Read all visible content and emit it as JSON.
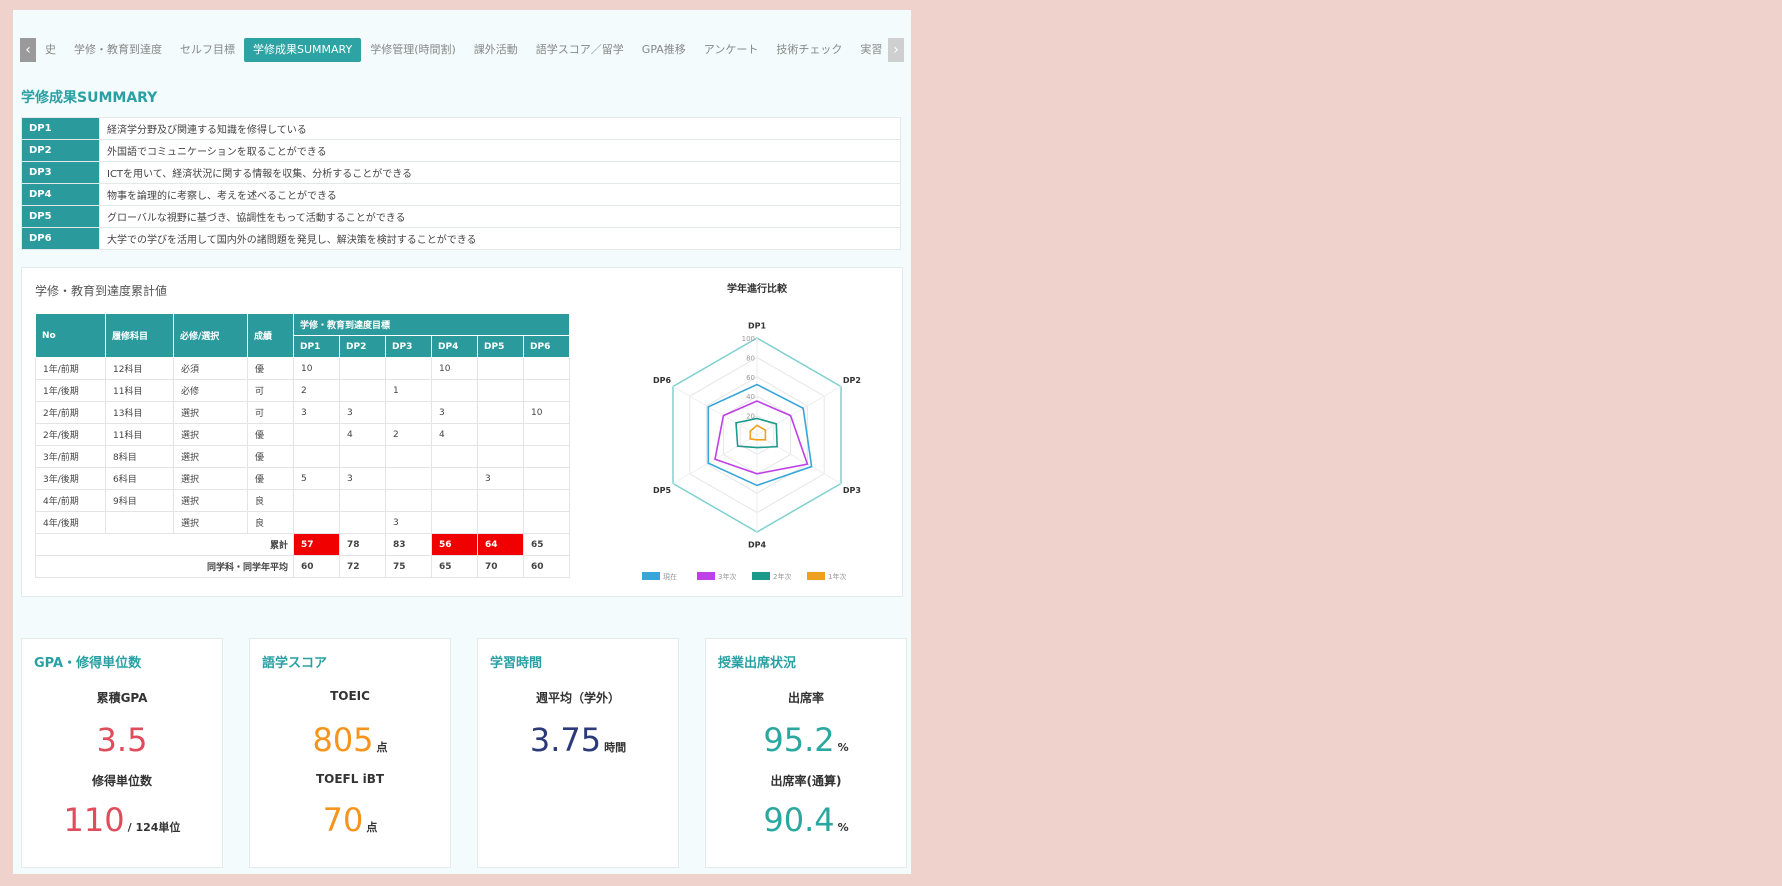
{
  "tabs": {
    "items": [
      "史",
      "学修・教育到達度",
      "セルフ目標",
      "学修成果SUMMARY",
      "学修管理(時間割)",
      "課外活動",
      "語学スコア／留学",
      "GPA推移",
      "アンケート",
      "技術チェック",
      "実習"
    ],
    "active_index": 3
  },
  "summary": {
    "title": "学修成果SUMMARY",
    "dp_list": [
      {
        "code": "DP1",
        "text": "経済学分野及び関連する知識を修得している"
      },
      {
        "code": "DP2",
        "text": "外国語でコミュニケーションを取ることができる"
      },
      {
        "code": "DP3",
        "text": "ICTを用いて、経済状況に関する情報を収集、分析することができる"
      },
      {
        "code": "DP4",
        "text": "物事を論理的に考察し、考えを述べることができる"
      },
      {
        "code": "DP5",
        "text": "グローバルな視野に基づき、協調性をもって活動することができる"
      },
      {
        "code": "DP6",
        "text": "大学での学びを活用して国内外の諸問題を発見し、解決策を検討することができる"
      }
    ]
  },
  "cumulative": {
    "title": "学修・教育到達度累計値",
    "headers": {
      "no": "No",
      "course": "履修科目",
      "req": "必修/選択",
      "grade": "成績",
      "target": "学修・教育到達度目標",
      "dps": [
        "DP1",
        "DP2",
        "DP3",
        "DP4",
        "DP5",
        "DP6"
      ]
    },
    "rows": [
      {
        "no": "1年/前期",
        "course": "12科目",
        "req": "必須",
        "grade": "優",
        "dp": [
          "10",
          "",
          "",
          "10",
          "",
          ""
        ]
      },
      {
        "no": "1年/後期",
        "course": "11科目",
        "req": "必修",
        "grade": "可",
        "dp": [
          "2",
          "",
          "1",
          "",
          "",
          ""
        ]
      },
      {
        "no": "2年/前期",
        "course": "13科目",
        "req": "選択",
        "grade": "可",
        "dp": [
          "3",
          "3",
          "",
          "3",
          "",
          "10"
        ]
      },
      {
        "no": "2年/後期",
        "course": "11科目",
        "req": "選択",
        "grade": "優",
        "dp": [
          "",
          "4",
          "2",
          "4",
          "",
          ""
        ]
      },
      {
        "no": "3年/前期",
        "course": "8科目",
        "req": "選択",
        "grade": "優",
        "dp": [
          "",
          "",
          "",
          "",
          "",
          ""
        ]
      },
      {
        "no": "3年/後期",
        "course": "6科目",
        "req": "選択",
        "grade": "優",
        "dp": [
          "5",
          "3",
          "",
          "",
          "3",
          ""
        ]
      },
      {
        "no": "4年/前期",
        "course": "9科目",
        "req": "選択",
        "grade": "良",
        "dp": [
          "",
          "",
          "",
          "",
          "",
          ""
        ]
      },
      {
        "no": "4年/後期",
        "course": "",
        "req": "選択",
        "grade": "良",
        "dp": [
          "",
          "",
          "3",
          "",
          "",
          ""
        ]
      }
    ],
    "total_label": "累計",
    "totals": [
      "57",
      "78",
      "83",
      "56",
      "64",
      "65"
    ],
    "totals_red": [
      true,
      false,
      false,
      true,
      true,
      false
    ],
    "avg_label": "同学科・同学年平均",
    "averages": [
      "60",
      "72",
      "75",
      "65",
      "70",
      "60"
    ]
  },
  "chart_data": {
    "type": "radar",
    "title": "学年進行比較",
    "axes": [
      "DP1",
      "DP2",
      "DP3",
      "DP4",
      "DP5",
      "DP6"
    ],
    "rmax": 100,
    "ticks": [
      20,
      40,
      60,
      80,
      100
    ],
    "series": [
      {
        "name": "現在",
        "color": "#37a6d9",
        "values": [
          52,
          55,
          65,
          52,
          58,
          58
        ]
      },
      {
        "name": "3年次",
        "color": "#c040e8",
        "values": [
          35,
          40,
          60,
          40,
          50,
          40
        ]
      },
      {
        "name": "2年次",
        "color": "#1a9a8a",
        "values": [
          17,
          23,
          24,
          13,
          23,
          25
        ]
      },
      {
        "name": "1年次",
        "color": "#f0a020",
        "values": [
          10,
          10,
          10,
          5,
          8,
          8
        ]
      }
    ],
    "outer_color": "#7fd0d0"
  },
  "cards": {
    "gpa": {
      "title": "GPA・修得単位数",
      "label1": "累積GPA",
      "value1": "3.5",
      "label2": "修得単位数",
      "value2": "110",
      "unit2": "/ 124単位"
    },
    "language": {
      "title": "語学スコア",
      "label1": "TOEIC",
      "value1": "805",
      "unit1": "点",
      "label2": "TOEFL iBT",
      "value2": "70",
      "unit2": "点"
    },
    "study": {
      "title": "学習時間",
      "label1": "週平均（学外）",
      "value1": "3.75",
      "unit1": "時間"
    },
    "attendance": {
      "title": "授業出席状況",
      "label1": "出席率",
      "value1": "95.2",
      "unit1": "%",
      "label2": "出席率(通算)",
      "value2": "90.4",
      "unit2": "%"
    }
  },
  "colors": {
    "accent": "#2aa0a4",
    "red_value": "#e04c5c",
    "orange_value": "#f5951e",
    "navy_value": "#2c3a7a",
    "teal_value": "#2aa8a0"
  }
}
